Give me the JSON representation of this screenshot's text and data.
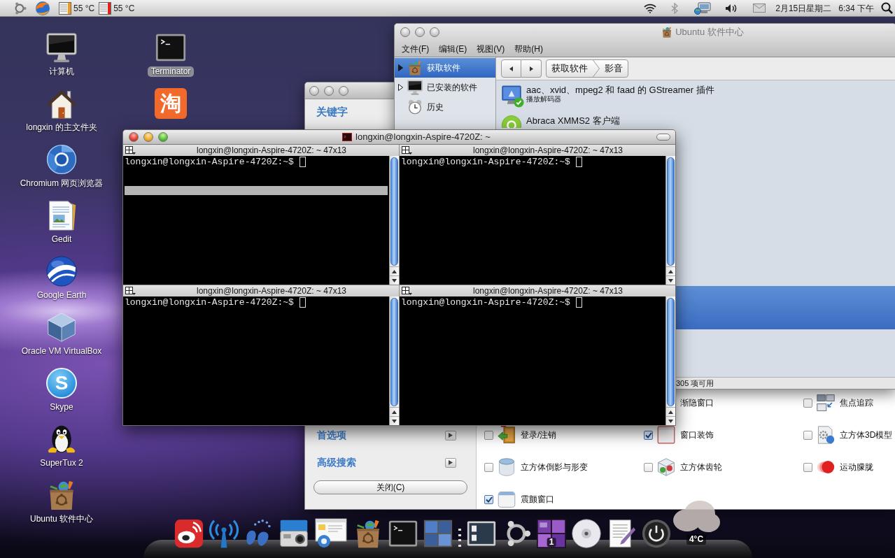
{
  "top_panel": {
    "sensors": [
      {
        "reading": "55 °C",
        "color": "#f39a1e"
      },
      {
        "reading": "55 °C",
        "color": "#e2231a"
      }
    ],
    "date": "2月15日星期二",
    "time": "6:34 下午"
  },
  "desktop_columns": [
    {
      "icons": [
        {
          "kind": "computer",
          "label": "计算机",
          "selected": false
        },
        {
          "kind": "home",
          "label": "longxin 的主文件夹",
          "selected": false
        },
        {
          "kind": "chromium",
          "label": "Chromium 网页浏览器",
          "selected": false
        },
        {
          "kind": "gedit",
          "label": "Gedit",
          "selected": false
        },
        {
          "kind": "earth",
          "label": "Google Earth",
          "selected": false
        },
        {
          "kind": "virtualbox",
          "label": "Oracle VM VirtualBox",
          "selected": false
        },
        {
          "kind": "skype",
          "glyph": "S",
          "label": "Skype",
          "selected": false
        },
        {
          "kind": "supertux",
          "label": "SuperTux 2",
          "selected": false
        },
        {
          "kind": "software-center",
          "label": "Ubuntu 软件中心",
          "selected": false
        }
      ]
    },
    {
      "icons": [
        {
          "kind": "terminal",
          "label": "Terminator",
          "selected": true
        },
        {
          "kind": "chat",
          "glyph": "淘"
        }
      ]
    }
  ],
  "settings_window": {
    "focused": false,
    "heading": "关键字",
    "links": [
      "首选项",
      "高级搜索"
    ],
    "close_button": "关闭(C)",
    "plugins": [
      {
        "label": "渐隐窗口"
      },
      {
        "label": "焦点追踪",
        "checked": false,
        "kind": "focus"
      },
      {
        "label": "登录/注销",
        "checked": false,
        "kind": "login"
      },
      {
        "label": "窗口装饰",
        "checked": true,
        "kind": "decoration"
      },
      {
        "label": "立方体3D模型",
        "checked": false,
        "kind": "cube-model"
      },
      {
        "label": "立方体倒影与形变",
        "checked": false,
        "kind": "cube-reflection"
      },
      {
        "label": "立方体齿轮",
        "checked": false,
        "kind": "cube-gears"
      },
      {
        "label": "运动朦胧",
        "checked": false,
        "kind": "motion-blur"
      },
      {
        "label": "震颤窗口",
        "checked": true,
        "kind": "wobbly"
      }
    ]
  },
  "software_center": {
    "focused": false,
    "title": "Ubuntu 软件中心",
    "menu": [
      "文件(F)",
      "编辑(E)",
      "视图(V)",
      "帮助(H)"
    ],
    "sidebar": [
      {
        "label": "获取软件",
        "kind": "store",
        "selected": true,
        "expandable": true
      },
      {
        "label": "已安装的软件",
        "kind": "installed",
        "selected": false,
        "expandable": true
      },
      {
        "label": "历史",
        "kind": "history",
        "selected": false,
        "expandable": false
      }
    ],
    "breadcrumbs": [
      "获取软件",
      "影音"
    ],
    "apps": [
      {
        "name": "aac、xvid、mpeg2 和 faad 的 GStreamer 插件",
        "subtitle": "播放解码器",
        "kind": "codec",
        "installed": true,
        "selected": false
      },
      {
        "name": "Abraca XMMS2 客户端",
        "kind": "player",
        "installed": false,
        "selected": false
      },
      {
        "selected": true
      }
    ],
    "status": "305 项可用"
  },
  "terminal_window": {
    "focused": true,
    "title": "longxin@longxin-Aspire-4720Z: ~",
    "panes": [
      {
        "title": "longxin@longxin-Aspire-4720Z: ~ 47x13",
        "prompt": "longxin@longxin-Aspire-4720Z:~$",
        "highlighted": true
      },
      {
        "title": "longxin@longxin-Aspire-4720Z: ~ 47x13",
        "prompt": "longxin@longxin-Aspire-4720Z:~$",
        "highlighted": false
      },
      {
        "title": "longxin@longxin-Aspire-4720Z: ~ 47x13",
        "prompt": "longxin@longxin-Aspire-4720Z:~$",
        "highlighted": false
      },
      {
        "title": "longxin@longxin-Aspire-4720Z: ~ 47x13",
        "prompt": "longxin@longxin-Aspire-4720Z:~$",
        "highlighted": false
      }
    ]
  },
  "dock": {
    "items": [
      {
        "kind": "weibo"
      },
      {
        "kind": "antenna"
      },
      {
        "kind": "footprints"
      },
      {
        "kind": "camera"
      },
      {
        "kind": "screenshot"
      },
      {
        "kind": "software-center"
      },
      {
        "kind": "terminal"
      },
      {
        "kind": "workspaces"
      },
      {
        "kind": "separator"
      },
      {
        "kind": "window-list"
      },
      {
        "kind": "ubuntu"
      },
      {
        "kind": "workspace-switcher",
        "badge": "1"
      },
      {
        "kind": "disc"
      },
      {
        "kind": "text-editor"
      },
      {
        "kind": "power"
      }
    ],
    "weather": {
      "temperature": "4°C"
    }
  }
}
